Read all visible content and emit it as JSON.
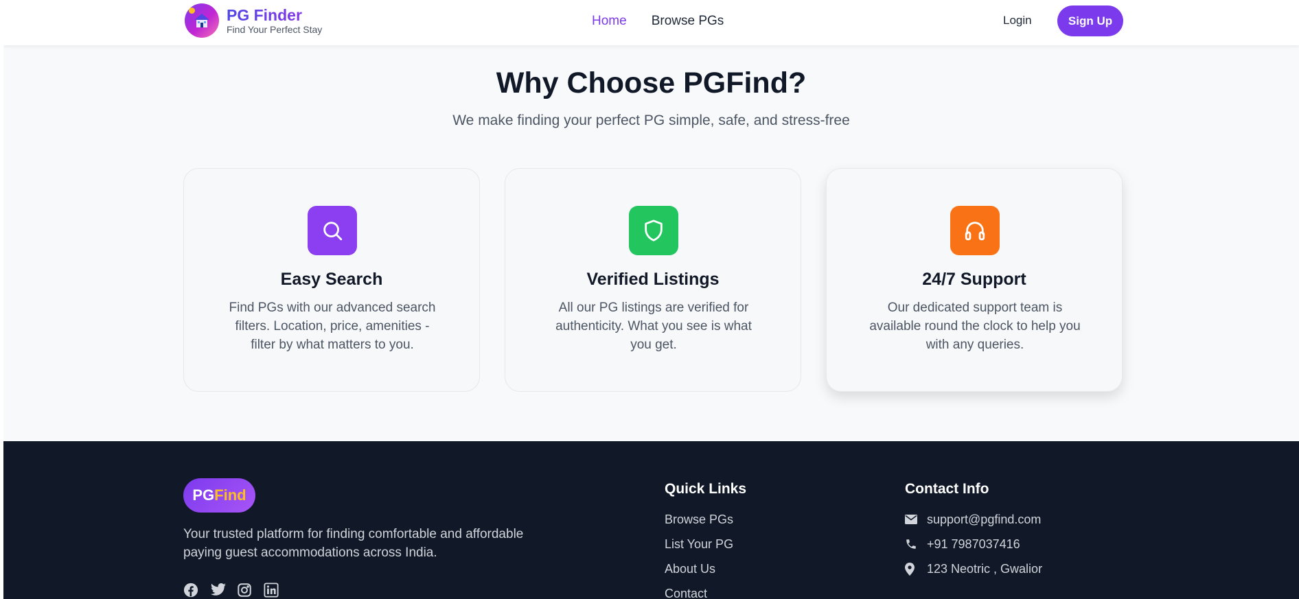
{
  "navbar": {
    "brand_name": "PG Finder",
    "brand_tagline": "Find Your Perfect Stay",
    "links": [
      {
        "label": "Home",
        "active": true
      },
      {
        "label": "Browse PGs",
        "active": false
      }
    ],
    "login_label": "Login",
    "signup_label": "Sign Up"
  },
  "why": {
    "title": "Why Choose PGFind?",
    "subtitle": "We make finding your perfect PG simple, safe, and stress-free",
    "cards": [
      {
        "icon": "search-icon",
        "color": "#8b3ff0",
        "title": "Easy Search",
        "desc": "Find PGs with our advanced search filters. Location, price, amenities - filter by what matters to you."
      },
      {
        "icon": "shield-icon",
        "color": "#22c55e",
        "title": "Verified Listings",
        "desc": "All our PG listings are verified for authenticity. What you see is what you get."
      },
      {
        "icon": "headphones-icon",
        "color": "#f97316",
        "title": "24/7 Support",
        "desc": "Our dedicated support team is available round the clock to help you with any queries."
      }
    ]
  },
  "footer": {
    "logo_pg": "PG",
    "logo_find": "Find",
    "description": "Your trusted platform for finding comfortable and affordable paying guest accommodations across India.",
    "socials": [
      "facebook-icon",
      "twitter-icon",
      "instagram-icon",
      "linkedin-icon"
    ],
    "quick_links_title": "Quick Links",
    "quick_links": [
      "Browse PGs",
      "List Your PG",
      "About Us",
      "Contact"
    ],
    "contact_title": "Contact Info",
    "contact": {
      "email": "support@pgfind.com",
      "phone": "+91 7987037416",
      "address": "123 Neotric , Gwalior"
    }
  },
  "colors": {
    "accent": "#7c3aed",
    "footer_bg": "#111827",
    "logo_yellow": "#fbbf24"
  }
}
